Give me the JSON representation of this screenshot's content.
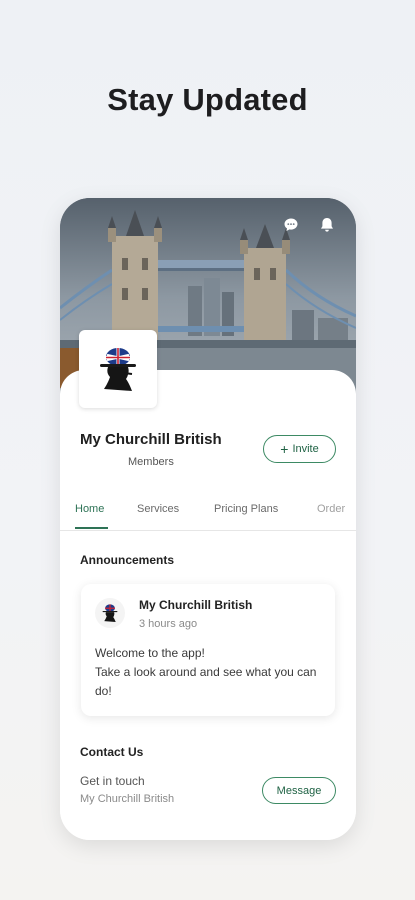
{
  "headline": "Stay Updated",
  "header": {
    "icons": [
      "chat-icon",
      "bell-icon"
    ]
  },
  "profile": {
    "site_name": "My Churchill British",
    "members_label": "Members",
    "invite_label": "Invite"
  },
  "tabs": [
    {
      "label": "Home",
      "active": true
    },
    {
      "label": "Services",
      "active": false
    },
    {
      "label": "Pricing Plans",
      "active": false
    },
    {
      "label": "Order",
      "active": false
    }
  ],
  "announcements": {
    "title": "Announcements",
    "post": {
      "author": "My Churchill British",
      "time": "3 hours ago",
      "body": "Welcome to the app!\nTake a look around and see what you can do!"
    }
  },
  "contact": {
    "title": "Contact Us",
    "subtitle": "Get in touch",
    "name": "My Churchill British",
    "message_label": "Message"
  },
  "colors": {
    "accent": "#2e7356",
    "button_border": "#3d8a64"
  }
}
